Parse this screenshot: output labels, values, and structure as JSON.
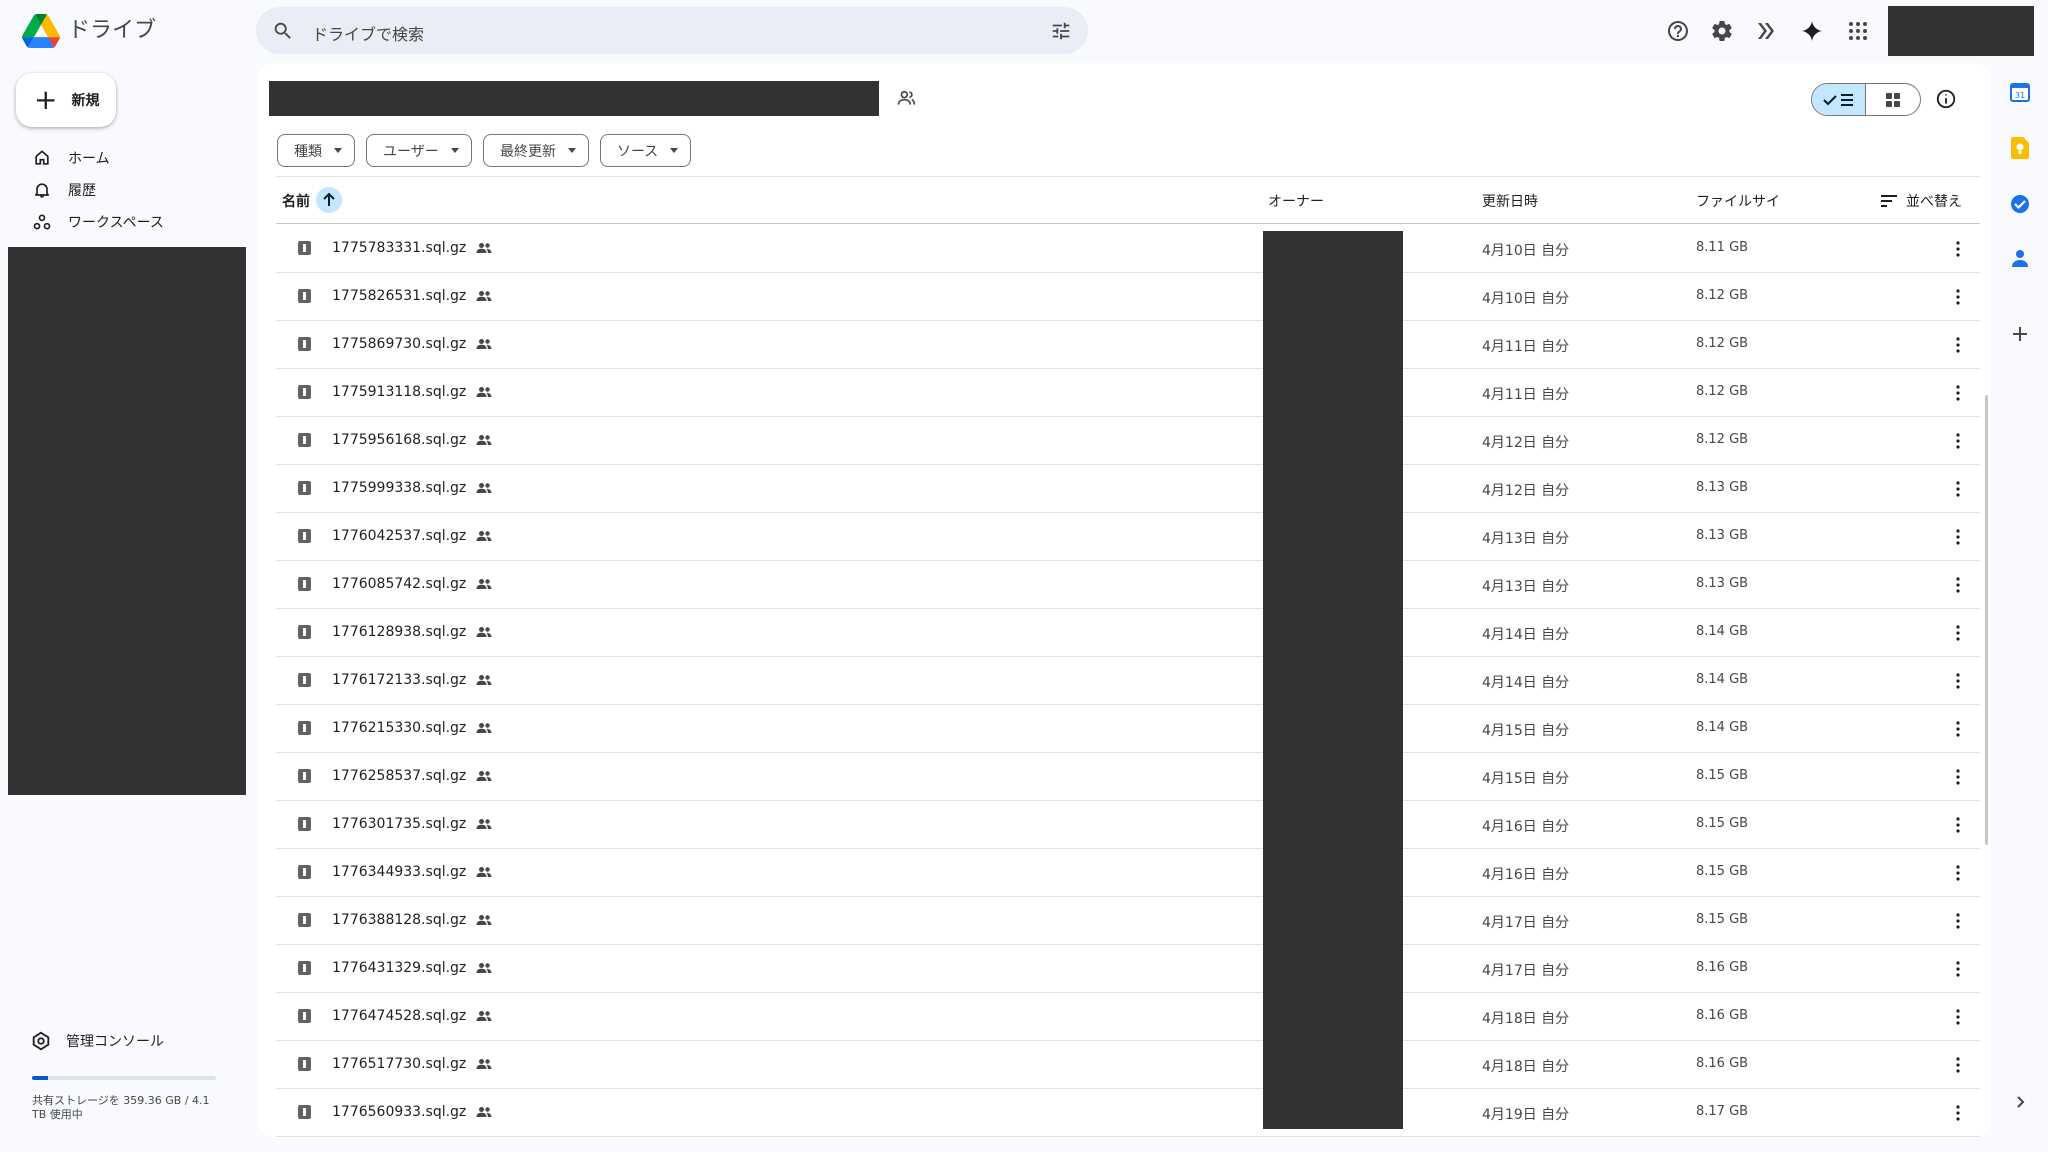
{
  "app": {
    "title": "ドライブ"
  },
  "search": {
    "placeholder": "ドライブで検索"
  },
  "sidebar": {
    "new_label": "新規",
    "items": [
      {
        "label": "ホーム",
        "icon": "home-icon"
      },
      {
        "label": "履歴",
        "icon": "bell-icon"
      },
      {
        "label": "ワークスペース",
        "icon": "workspaces-icon"
      }
    ],
    "admin_label": "管理コンソール",
    "storage": {
      "text": "共有ストレージを 359.36 GB / 4.1 TB 使用中",
      "used_fraction": 0.088
    }
  },
  "filters": [
    "種類",
    "ユーザー",
    "最終更新",
    "ソース"
  ],
  "table": {
    "headers": {
      "name": "名前",
      "owner": "オーナー",
      "modified": "更新日時",
      "size": "ファイルサイ",
      "sort": "並べ替え"
    },
    "rows": [
      {
        "name": "1775783331.sql.gz",
        "modified": "4月10日 自分",
        "size": "8.11 GB"
      },
      {
        "name": "1775826531.sql.gz",
        "modified": "4月10日 自分",
        "size": "8.12 GB"
      },
      {
        "name": "1775869730.sql.gz",
        "modified": "4月11日 自分",
        "size": "8.12 GB"
      },
      {
        "name": "1775913118.sql.gz",
        "modified": "4月11日 自分",
        "size": "8.12 GB"
      },
      {
        "name": "1775956168.sql.gz",
        "modified": "4月12日 自分",
        "size": "8.12 GB"
      },
      {
        "name": "1775999338.sql.gz",
        "modified": "4月12日 自分",
        "size": "8.13 GB"
      },
      {
        "name": "1776042537.sql.gz",
        "modified": "4月13日 自分",
        "size": "8.13 GB"
      },
      {
        "name": "1776085742.sql.gz",
        "modified": "4月13日 自分",
        "size": "8.13 GB"
      },
      {
        "name": "1776128938.sql.gz",
        "modified": "4月14日 自分",
        "size": "8.14 GB"
      },
      {
        "name": "1776172133.sql.gz",
        "modified": "4月14日 自分",
        "size": "8.14 GB"
      },
      {
        "name": "1776215330.sql.gz",
        "modified": "4月15日 自分",
        "size": "8.14 GB"
      },
      {
        "name": "1776258537.sql.gz",
        "modified": "4月15日 自分",
        "size": "8.15 GB"
      },
      {
        "name": "1776301735.sql.gz",
        "modified": "4月16日 自分",
        "size": "8.15 GB"
      },
      {
        "name": "1776344933.sql.gz",
        "modified": "4月16日 自分",
        "size": "8.15 GB"
      },
      {
        "name": "1776388128.sql.gz",
        "modified": "4月17日 自分",
        "size": "8.15 GB"
      },
      {
        "name": "1776431329.sql.gz",
        "modified": "4月17日 自分",
        "size": "8.16 GB"
      },
      {
        "name": "1776474528.sql.gz",
        "modified": "4月18日 自分",
        "size": "8.16 GB"
      },
      {
        "name": "1776517730.sql.gz",
        "modified": "4月18日 自分",
        "size": "8.16 GB"
      },
      {
        "name": "1776560933.sql.gz",
        "modified": "4月19日 自分",
        "size": "8.17 GB"
      }
    ]
  },
  "colors": {
    "accent": "#0b57d0",
    "selected": "#c2e7ff",
    "search_bg": "#e9eef6",
    "page_bg": "#f8fafd"
  }
}
